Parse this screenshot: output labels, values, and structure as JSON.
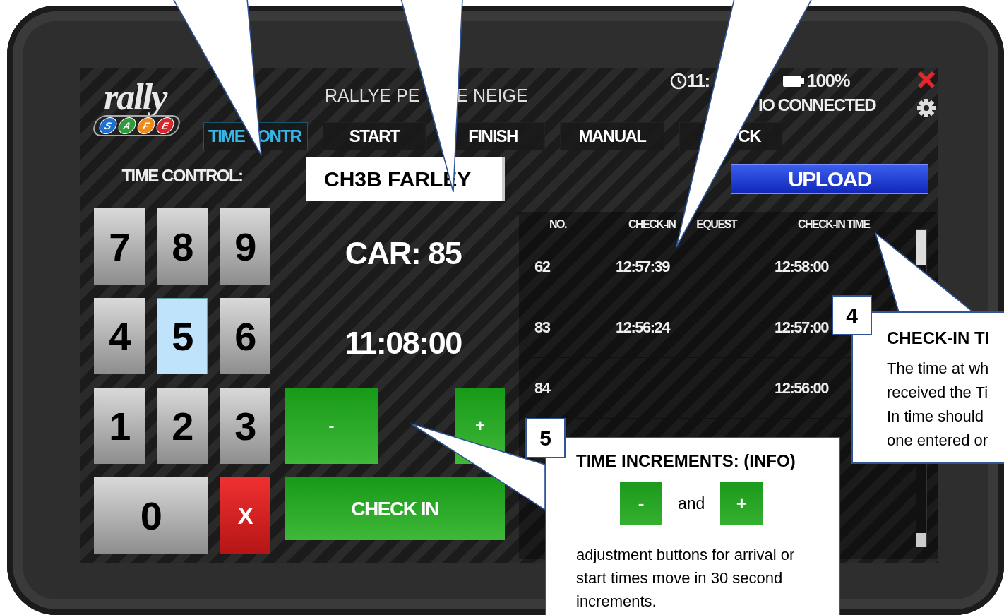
{
  "logo": {
    "word": "rally",
    "letters": [
      {
        "char": "S",
        "color": "#1f6fd1"
      },
      {
        "char": "A",
        "color": "#2f9b3b"
      },
      {
        "char": "F",
        "color": "#ef8a1d"
      },
      {
        "char": "E",
        "color": "#d7262c"
      }
    ]
  },
  "header": {
    "title_parts": [
      "RALLYE PE",
      "E NEIGE"
    ],
    "clock": "11:",
    "battery": "100%",
    "status": "IO CONNECTED"
  },
  "tabs": [
    {
      "labels": [
        "TIME",
        "ONTR"
      ],
      "selected": true
    },
    {
      "labels": [
        "START"
      ],
      "selected": false
    },
    {
      "labels": [
        "FINISH"
      ],
      "selected": false
    },
    {
      "labels": [
        "MANUAL"
      ],
      "selected": false
    },
    {
      "labels": [
        "CK"
      ],
      "selected": false
    }
  ],
  "control": {
    "label": "TIME CONTROL:",
    "value": "CH3B FARLEY",
    "upload": "UPLOAD"
  },
  "keypad": [
    {
      "label": "7",
      "kind": "digit",
      "selected": false
    },
    {
      "label": "8",
      "kind": "digit",
      "selected": false
    },
    {
      "label": "9",
      "kind": "digit",
      "selected": false
    },
    {
      "label": "4",
      "kind": "digit",
      "selected": false
    },
    {
      "label": "5",
      "kind": "digit",
      "selected": true
    },
    {
      "label": "6",
      "kind": "digit",
      "selected": false
    },
    {
      "label": "1",
      "kind": "digit",
      "selected": false
    },
    {
      "label": "2",
      "kind": "digit",
      "selected": false
    },
    {
      "label": "3",
      "kind": "digit",
      "selected": false
    },
    {
      "label": "0",
      "kind": "wide",
      "selected": false
    },
    {
      "label": "X",
      "kind": "clear",
      "selected": false
    }
  ],
  "entry": {
    "car": "CAR: 85",
    "time": "11:08:00",
    "minus": "-",
    "plus": "+",
    "check_in": "CHECK IN"
  },
  "table": {
    "columns": [
      {
        "parts": [
          "NO."
        ]
      },
      {
        "parts": [
          "CHECK-IN",
          "EQUEST"
        ]
      },
      {
        "parts": [
          "CHECK-IN TIME"
        ]
      }
    ],
    "rows": [
      {
        "no": "62",
        "request": "12:57:39",
        "time": "12:58:00"
      },
      {
        "no": "83",
        "request": "12:56:24",
        "time": "12:57:00"
      },
      {
        "no": "84",
        "time": "12:56:00"
      }
    ]
  },
  "callouts": [
    {
      "kind": "text",
      "number": "4",
      "title": "CHECK-IN TI",
      "lines": [
        "The time at wh",
        "received the Ti",
        "In time should",
        "one entered or"
      ]
    },
    {
      "kind": "buttons",
      "number": "5",
      "title": "TIME INCREMENTS: (INFO)",
      "minus": "-",
      "conjunction": "and",
      "plus": "+",
      "body": "adjustment buttons for arrival or start times move in 30 second increments."
    }
  ]
}
